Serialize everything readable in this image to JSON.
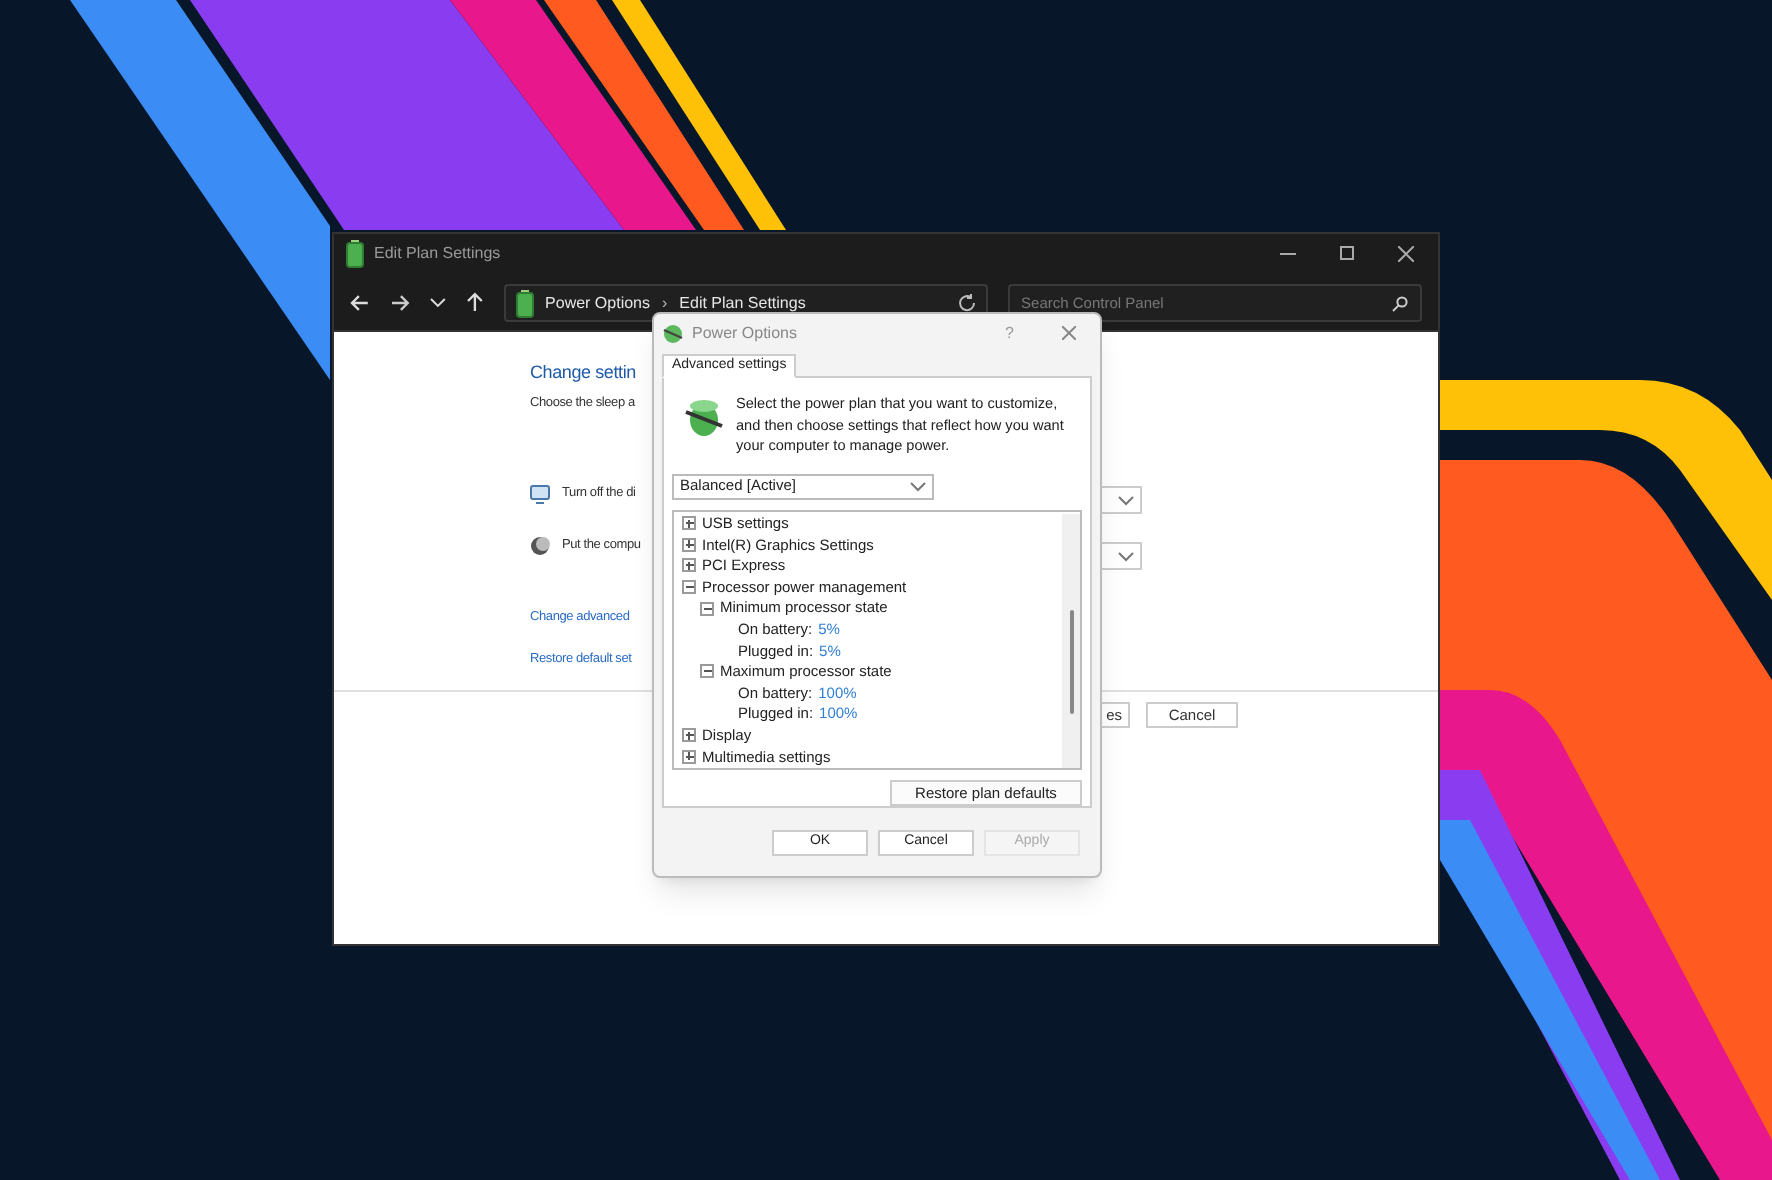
{
  "explorer": {
    "title": "Edit Plan Settings",
    "breadcrumb": [
      "Power Options",
      "Edit Plan Settings"
    ],
    "separator": "›",
    "search": {
      "placeholder": "Search Control Panel"
    },
    "heading": "Change settin",
    "subtitle": "Choose the sleep a",
    "settings": [
      "Turn off the di",
      "Put the compu"
    ],
    "links": [
      "Change advanced",
      "Restore default set"
    ],
    "buttons": [
      {
        "label": "es"
      },
      {
        "label": "Cancel"
      }
    ]
  },
  "dialog": {
    "title": "Power Options",
    "help": "?",
    "tabs": [
      {
        "label": "Advanced settings",
        "selected": true
      }
    ],
    "intro": "Select the power plan that you want to customize, and then choose settings that reflect how you want your computer to manage power.",
    "plan": "Balanced [Active]",
    "tree": [
      {
        "kind": "group",
        "label": "USB settings",
        "expanded": false
      },
      {
        "kind": "group",
        "label": "Intel(R) Graphics Settings",
        "expanded": false
      },
      {
        "kind": "group",
        "label": "PCI Express",
        "expanded": false
      },
      {
        "kind": "group",
        "label": "Processor power management",
        "expanded": true,
        "children": [
          {
            "kind": "group",
            "label": "Minimum processor state",
            "expanded": true,
            "children": [
              {
                "kind": "setting",
                "label": "On battery:",
                "value": "5%"
              },
              {
                "kind": "setting",
                "label": "Plugged in:",
                "value": "5%"
              }
            ]
          },
          {
            "kind": "group",
            "label": "Maximum processor state",
            "expanded": true,
            "children": [
              {
                "kind": "setting",
                "label": "On battery:",
                "value": "100%"
              },
              {
                "kind": "setting",
                "label": "Plugged in:",
                "value": "100%"
              }
            ]
          }
        ]
      },
      {
        "kind": "group",
        "label": "Display",
        "expanded": false
      },
      {
        "kind": "group",
        "label": "Multimedia settings",
        "expanded": false
      }
    ],
    "restore": "Restore plan defaults",
    "buttons": [
      {
        "label": "OK",
        "disabled": false
      },
      {
        "label": "Cancel",
        "disabled": false
      },
      {
        "label": "Apply",
        "disabled": true
      }
    ]
  }
}
